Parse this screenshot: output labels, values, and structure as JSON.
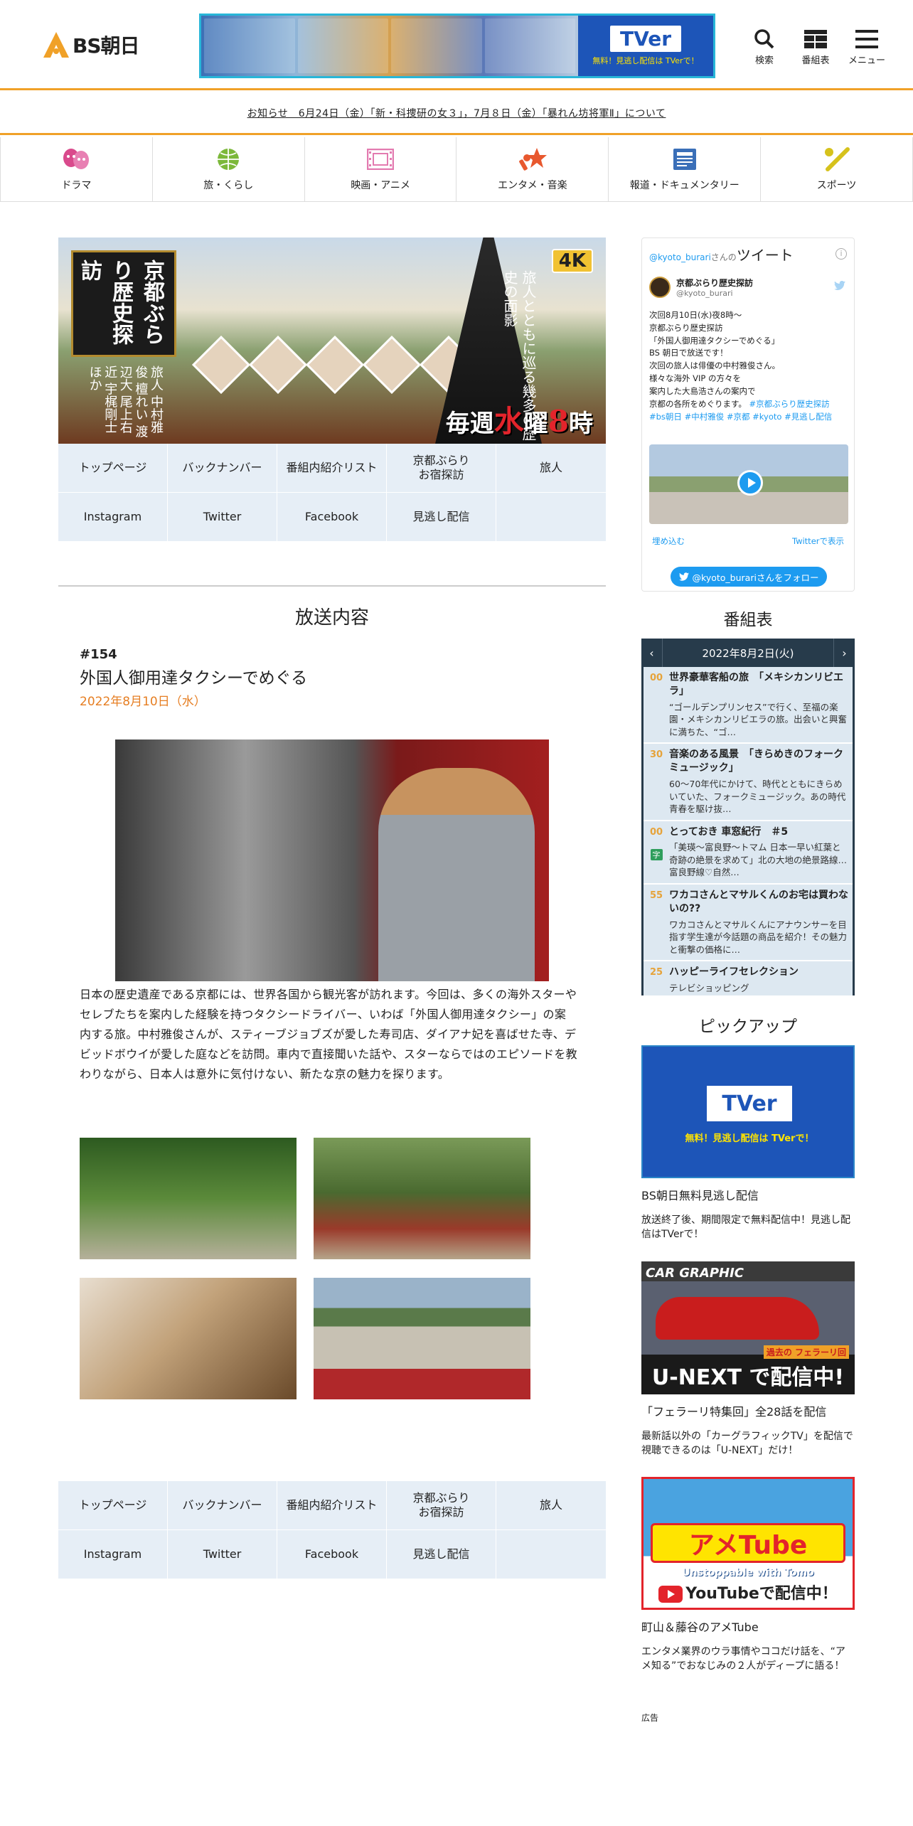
{
  "header": {
    "logo_text": "BS朝日",
    "banner": {
      "tver_label": "TVer",
      "tver_note": "無料！見逃し配信は TVerで！"
    },
    "icons": [
      {
        "name": "search-icon",
        "label": "検索"
      },
      {
        "name": "grid-icon",
        "label": "番組表"
      },
      {
        "name": "menu-icon",
        "label": "メニュー"
      }
    ]
  },
  "notice": "お知らせ　6月24日（金）「新・科捜研の女３」，7月８日（金）「暴れん坊将軍Ⅱ」について",
  "genre_nav": [
    {
      "label": "ドラマ",
      "color": "#d94a8c"
    },
    {
      "label": "旅・くらし",
      "color": "#7cb83a"
    },
    {
      "label": "映画・アニメ",
      "color": "#e37bb0"
    },
    {
      "label": "エンタメ・音楽",
      "color": "#e8582e"
    },
    {
      "label": "報道・ドキュメンタリー",
      "color": "#3a6fb8"
    },
    {
      "label": "スポーツ",
      "color": "#d6c21c"
    }
  ],
  "hero": {
    "title": "京都ぶらり歴史探訪",
    "tagline": "旅人とともに巡る幾多の歴史の面影",
    "badge": "4K",
    "weekly_prefix": "毎週",
    "weekly_day": "水",
    "weekly_mid": "曜",
    "weekly_time": "8",
    "weekly_suffix": "時",
    "cast": "旅人 中村雅俊 檀れい 渡辺大 尾上右近 宇梶剛士 ほか"
  },
  "program_nav": [
    "トップページ",
    "バックナンバー",
    "番組内紹介リスト",
    "京都ぶらり\nお宿探訪",
    "旅人",
    "Instagram",
    "Twitter",
    "Facebook",
    "見逃し配信",
    ""
  ],
  "broadcast": {
    "heading": "放送内容",
    "number": "#154",
    "title": "外国人御用達タクシーでめぐる",
    "date": "2022年8月10日（水）",
    "body": "日本の歴史遺産である京都には、世界各国から観光客が訪れます。今回は、多くの海外スターやセレブたちを案内した経験を持つタクシードライバー、いわば「外国人御用達タクシー」の案内する旅。中村雅俊さんが、スティーブジョブズが愛した寿司店、ダイアナ妃を喜ばせた寺、デビッドボウイが愛した庭などを訪問。車内で直接聞いた話や、スターならではのエピソードを教わりながら、日本人は意外に気付けない、新たな京の魅力を探ります。"
  },
  "twitter": {
    "handle_prefix": "@kyoto_burari",
    "handle_suffix": "さんの",
    "heading": "ツイート",
    "info": "i",
    "user_name": "京都ぶらり歴史探訪",
    "user_handle": "@kyoto_burari",
    "text": "次回8月10日(水)夜8時〜\n京都ぶらり歴史探訪\n「外国人御用達タクシーでめぐる」\nBS 朝日で放送です！\n次回の旅人は俳優の中村雅俊さん。\n様々な海外 VIP の方々を\n案内した大島浩さんの案内で\n京都の各所をめぐります。",
    "hashtags": "#京都ぶらり歴史探訪 #bs朝日 #中村雅俊 #京都 #kyoto #見逃し配信",
    "embed": "埋め込む",
    "view": "Twitterで表示",
    "follow": "@kyoto_burariさんをフォロー"
  },
  "epg": {
    "heading": "番組表",
    "date": "2022年8月2日(火)",
    "prev": "‹",
    "next": "›",
    "items": [
      {
        "time": "00",
        "title": "世界豪華客船の旅　「メキシカンリビエラ」",
        "desc": "“ゴールデンプリンセス”で行く、至福の楽園・メキシカンリビエラの旅。出会いと興奮に満ちた、“ゴ…",
        "badge": ""
      },
      {
        "time": "30",
        "title": "音楽のある風景　「きらめきのフォークミュージック」",
        "desc": "60〜70年代にかけて、時代とともにきらめいていた、フォークミュージック。あの時代 青春を駆け抜…",
        "badge": ""
      },
      {
        "time": "00",
        "title": "とっておき 車窓紀行　＃5",
        "desc": "「美瑛〜富良野〜トマム 日本一早い紅葉と奇跡の絶景を求めて」北の大地の絶景路線…富良野線♡自然…",
        "badge": "字"
      },
      {
        "time": "55",
        "title": "ワカコさんとマサルくんのお宅は買わないの??",
        "desc": "ワカコさんとマサルくんにアナウンサーを目指す学生達が今話題の商品を紹介！その魅力と衝撃の価格に…",
        "badge": ""
      },
      {
        "time": "25",
        "title": "ハッピーライフセレクション",
        "desc": "テレビショッピング",
        "badge": ""
      }
    ]
  },
  "pickup": {
    "heading": "ピックアップ",
    "items": [
      {
        "title": "BS朝日無料見逃し配信",
        "desc": "放送終了後、期間限定で無料配信中！見逃し配信はTVerで！",
        "img_label": "TVer",
        "img_note": "無料！見逃し配信は TVerで！"
      },
      {
        "title": "「フェラーリ特集回」全28話を配信",
        "desc": "最新話以外の「カーグラフィックTV」を配信で視聴できるのは「U-NEXT」だけ！",
        "img_label": "U-NEXT で配信中!",
        "img_brand": "CAR GRAPHIC",
        "img_tag": "過去の フェラーリ回"
      },
      {
        "title": "町山＆藤谷のアメTube",
        "desc": "エンタメ業界のウラ事情やココだけ話を、“アメ知る”でおなじみの２人がディープに語る！",
        "img_label": "アメTube",
        "img_sub": "Unstoppable with Tomo",
        "img_yt": "YouTubeで配信中！"
      }
    ]
  },
  "ad_label": "広告"
}
